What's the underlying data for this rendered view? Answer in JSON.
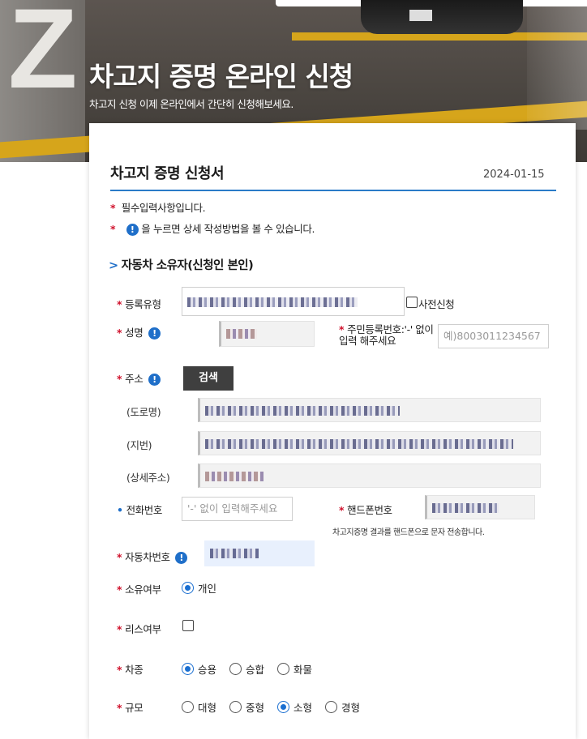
{
  "hero": {
    "title": "차고지 증명 온라인 신청",
    "subtitle": "차고지 신청 이제 온라인에서 간단히 신청해보세요.",
    "pillar_text": "Z"
  },
  "form": {
    "title": "차고지 증명 신청서",
    "date": "2024-01-15",
    "notes": {
      "required": "필수입력사항입니다.",
      "info": "을 누르면 상세 작성방법을 볼 수 있습니다."
    },
    "section_title": "자동차 소유자(신청인 본인)",
    "required_mark": "*",
    "info_icon_glyph": "!",
    "fields": {
      "registration_type": {
        "label": "등록유형"
      },
      "pre_apply": {
        "label": "사전신청"
      },
      "name": {
        "label": "성명"
      },
      "resident_number": {
        "label": "주민등록번호:'-' 없이 입력 해주세요",
        "placeholder": "예)8003011234567"
      },
      "address": {
        "label": "주소",
        "search_button": "검색"
      },
      "road_address": {
        "label": "(도로명)"
      },
      "lot_address": {
        "label": "(지번)"
      },
      "detail_address": {
        "label": "(상세주소)"
      },
      "phone": {
        "label": "전화번호",
        "placeholder": "'-' 없이 입력해주세요"
      },
      "mobile": {
        "label": "핸드폰번호",
        "note": "차고지증명 결과를 핸드폰으로 문자 전송합니다."
      },
      "car_number": {
        "label": "자동차번호"
      },
      "ownership": {
        "label": "소유여부",
        "options": [
          "개인"
        ],
        "selected": "개인"
      },
      "lease": {
        "label": "리스여부",
        "checked": false
      },
      "car_type": {
        "label": "차종",
        "options": [
          "승용",
          "승합",
          "화물"
        ],
        "selected": "승용"
      },
      "size": {
        "label": "규모",
        "options": [
          "대형",
          "중형",
          "소형",
          "경형"
        ],
        "selected": "소형"
      }
    }
  },
  "colors": {
    "accent": "#1f6fc9",
    "required": "#d0102b",
    "button": "#3f3f3f"
  }
}
